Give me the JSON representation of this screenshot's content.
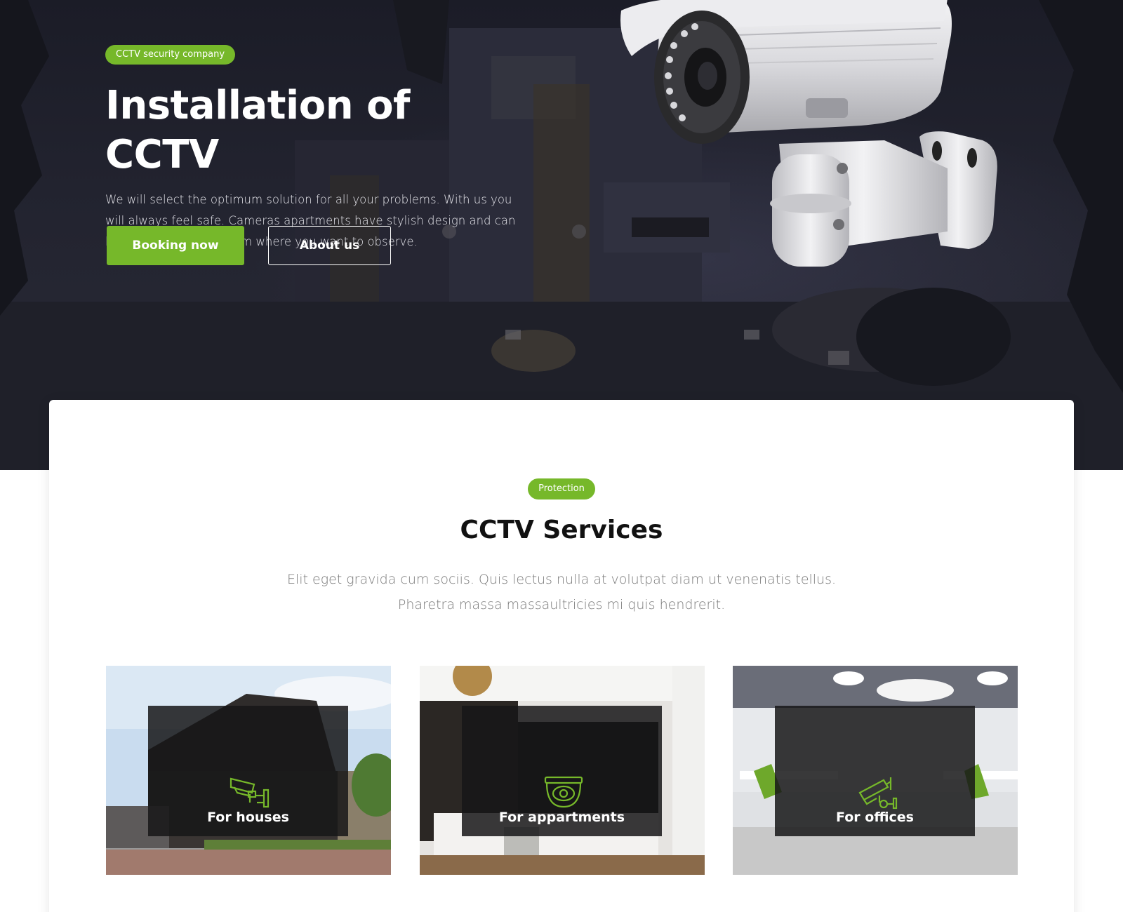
{
  "hero": {
    "badge": "CCTV security company",
    "title": "Installation of CCTV",
    "description": "We will select the optimum solution for all your problems. With us you will always feel safe. Cameras apartments have stylish design and can be installed in each room where you want to observe.",
    "primary_button": "Booking now",
    "secondary_button": "About us"
  },
  "services": {
    "badge": "Protection",
    "title": "CCTV Services",
    "description_line1": "Elit eget gravida cum sociis. Quis lectus nulla at volutpat diam ut venenatis tellus.",
    "description_line2": "Pharetra massa massaultricies mi quis hendrerit.",
    "items": [
      {
        "label": "For houses",
        "icon": "bullet-camera-icon"
      },
      {
        "label": "For appartments",
        "icon": "dome-camera-icon"
      },
      {
        "label": "For offices",
        "icon": "wall-camera-icon"
      }
    ]
  },
  "colors": {
    "accent": "#76b82a",
    "hero_bg": "#22232f",
    "heading": "#111111",
    "muted_text": "#7a7a7a"
  }
}
